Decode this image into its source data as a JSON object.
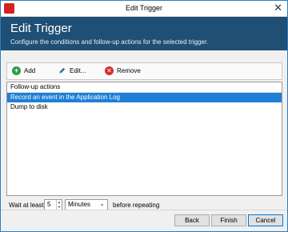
{
  "window": {
    "title": "Edit Trigger",
    "app_icon_label": "",
    "close_glyph": "✕"
  },
  "header": {
    "title": "Edit Trigger",
    "subtitle": "Configure the conditions and follow-up actions for the selected trigger."
  },
  "toolbar": {
    "add_label": "Add",
    "edit_label": "Edit...",
    "remove_label": "Remove",
    "icons": {
      "add": "plus-circle-icon",
      "edit": "pencil-icon",
      "remove": "x-circle-icon"
    }
  },
  "list": {
    "header": "Follow-up actions",
    "items": [
      {
        "label": "Record an event in the Application Log",
        "selected": true
      },
      {
        "label": "Dump to disk",
        "selected": false
      }
    ]
  },
  "wait": {
    "prefix": "Wait at least",
    "value": "5",
    "unit": "Minutes",
    "suffix": "before repeating"
  },
  "footer": {
    "back_label": "Back",
    "finish_label": "Finish",
    "cancel_label": "Cancel"
  },
  "colors": {
    "header_bg": "#1f4f74",
    "selection": "#1f7fd6",
    "add_icon": "#2e9b48",
    "remove_icon": "#d82b2b"
  }
}
